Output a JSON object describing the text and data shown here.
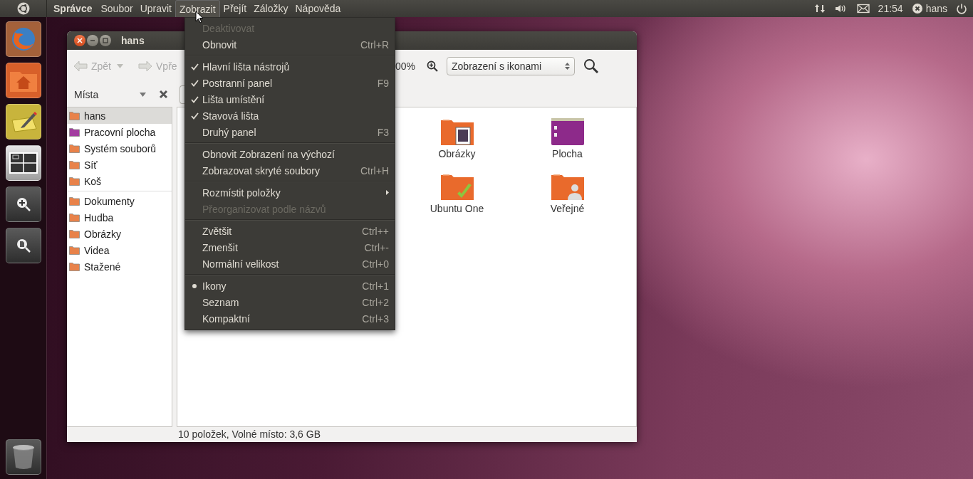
{
  "top_panel": {
    "app_name": "Správce",
    "menus": [
      {
        "label": "Soubor",
        "selected": false
      },
      {
        "label": "Upravit",
        "selected": false
      },
      {
        "label": "Zobrazit",
        "selected": true
      },
      {
        "label": "Přejít",
        "selected": false
      },
      {
        "label": "Záložky",
        "selected": false
      },
      {
        "label": "Nápověda",
        "selected": false
      }
    ],
    "clock": "21:54",
    "user": "hans"
  },
  "window": {
    "title": "hans",
    "toolbar": {
      "back": {
        "label": "Zpět",
        "disabled": true
      },
      "forward": {
        "label": "Vpře"
      },
      "zoom": "00%",
      "view_select": "Zobrazení s ikonami"
    },
    "sidebar": {
      "title": "Místa",
      "groups": [
        [
          {
            "label": "hans",
            "selected": true
          },
          {
            "label": "Pracovní plocha",
            "selected": false
          },
          {
            "label": "Systém souborů",
            "selected": false
          },
          {
            "label": "Síť",
            "selected": false
          },
          {
            "label": "Koš",
            "selected": false
          }
        ],
        [
          {
            "label": "Dokumenty",
            "selected": false
          },
          {
            "label": "Hudba",
            "selected": false
          },
          {
            "label": "Obrázky",
            "selected": false
          },
          {
            "label": "Videa",
            "selected": false
          },
          {
            "label": "Stažené",
            "selected": false
          }
        ]
      ]
    },
    "files": [
      {
        "name": "Obrázky",
        "kind": "pictures"
      },
      {
        "name": "Plocha",
        "kind": "desktop"
      },
      {
        "name": "Ubuntu One",
        "kind": "synced"
      },
      {
        "name": "Veřejné",
        "kind": "public"
      }
    ],
    "status_bar": "10 položek, Volné místo: 3,6 GB"
  },
  "view_menu": {
    "sections": [
      [
        {
          "label": "Deaktivovat",
          "kind": "plain",
          "disabled": true
        },
        {
          "label": "Obnovit",
          "kind": "plain",
          "disabled": false,
          "shortcut": "Ctrl+R"
        }
      ],
      [
        {
          "label": "Hlavní lišta nástrojů",
          "kind": "check",
          "checked": true,
          "disabled": false
        },
        {
          "label": "Postranní panel",
          "kind": "check",
          "checked": true,
          "disabled": false,
          "shortcut": "F9"
        },
        {
          "label": "Lišta umístění",
          "kind": "check",
          "checked": true,
          "disabled": false
        },
        {
          "label": "Stavová lišta",
          "kind": "check",
          "checked": true,
          "disabled": false
        },
        {
          "label": "Druhý panel",
          "kind": "check",
          "checked": false,
          "disabled": false,
          "shortcut": "F3"
        }
      ],
      [
        {
          "label": "Obnovit Zobrazení na výchozí",
          "kind": "plain",
          "disabled": false
        },
        {
          "label": "Zobrazovat skryté soubory",
          "kind": "check",
          "checked": false,
          "disabled": false,
          "shortcut": "Ctrl+H"
        }
      ],
      [
        {
          "label": "Rozmístit položky",
          "kind": "submenu",
          "disabled": false
        },
        {
          "label": "Přeorganizovat podle názvů",
          "kind": "plain",
          "disabled": true
        }
      ],
      [
        {
          "label": "Zvětšit",
          "kind": "plain",
          "disabled": false,
          "shortcut": "Ctrl++"
        },
        {
          "label": "Zmenšit",
          "kind": "plain",
          "disabled": false,
          "shortcut": "Ctrl+-"
        },
        {
          "label": "Normální velikost",
          "kind": "plain",
          "disabled": false,
          "shortcut": "Ctrl+0"
        }
      ],
      [
        {
          "label": "Ikony",
          "kind": "radio",
          "checked": true,
          "disabled": false,
          "shortcut": "Ctrl+1"
        },
        {
          "label": "Seznam",
          "kind": "radio",
          "checked": false,
          "disabled": false,
          "shortcut": "Ctrl+2"
        },
        {
          "label": "Kompaktní",
          "kind": "radio",
          "checked": false,
          "disabled": false,
          "shortcut": "Ctrl+3"
        }
      ]
    ]
  }
}
